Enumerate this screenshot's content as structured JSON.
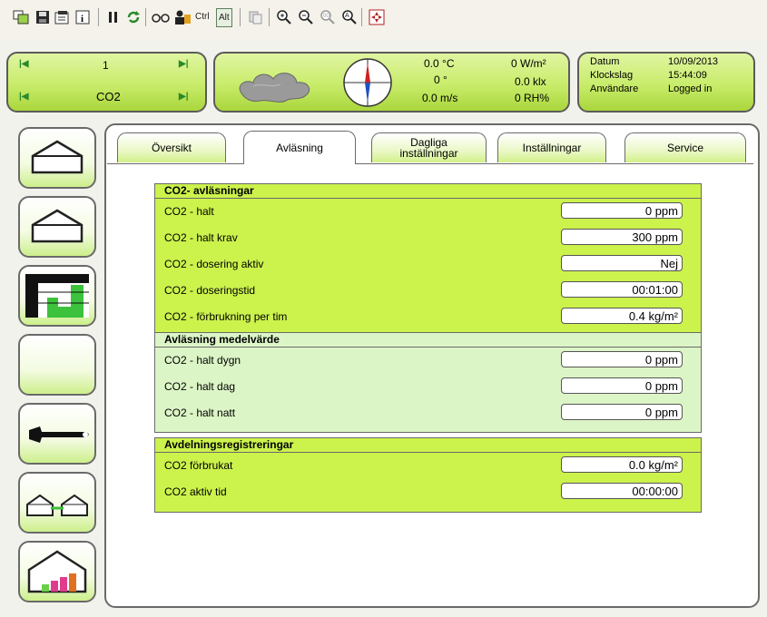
{
  "toolbar": {
    "ctrl_label": "Ctrl",
    "alt_label": "Alt"
  },
  "selector": {
    "top_value": "1",
    "bottom_value": "CO2"
  },
  "weather": {
    "temperature": "0.0 °C",
    "direction": "0 °",
    "wind_speed": "0.0 m/s",
    "radiation": "0 W/m²",
    "light": "0.0 klx",
    "humidity": "0 RH%"
  },
  "info": {
    "date_label": "Datum",
    "date_value": "10/09/2013",
    "time_label": "Klockslag",
    "time_value": "15:44:09",
    "user_label": "Användare",
    "user_value": "Logged in"
  },
  "tabs": {
    "overview": "Översikt",
    "reading": "Avläsning",
    "daily_line1": "Dagliga",
    "daily_line2": "inställningar",
    "settings": "Inställningar",
    "service": "Service"
  },
  "sections": {
    "co2_readings": {
      "title": "CO2- avläsningar",
      "rows": [
        {
          "label": "CO2 - halt",
          "value": "0 ppm"
        },
        {
          "label": "CO2 - halt krav",
          "value": "300 ppm"
        },
        {
          "label": "CO2 - dosering aktiv",
          "value": "Nej"
        },
        {
          "label": "CO2 - doseringstid",
          "value": "00:01:00"
        },
        {
          "label": "CO2 - förbrukning per tim",
          "value": "0.4 kg/m²"
        }
      ]
    },
    "average": {
      "title": "Avläsning medelvärde",
      "rows": [
        {
          "label": "CO2 - halt dygn",
          "value": "0 ppm"
        },
        {
          "label": "CO2 - halt dag",
          "value": "0 ppm"
        },
        {
          "label": "CO2 - halt natt",
          "value": "0 ppm"
        }
      ]
    },
    "department": {
      "title": "Avdelningsregistreringar",
      "rows": [
        {
          "label": "CO2 förbrukat",
          "value": "0.0 kg/m²"
        },
        {
          "label": "CO2 aktiv tid",
          "value": "00:00:00"
        }
      ]
    }
  },
  "colors": {
    "lime": "#ccf24c",
    "pale_green": "#dcf5c6",
    "panel_green": "#c8ec6a"
  }
}
